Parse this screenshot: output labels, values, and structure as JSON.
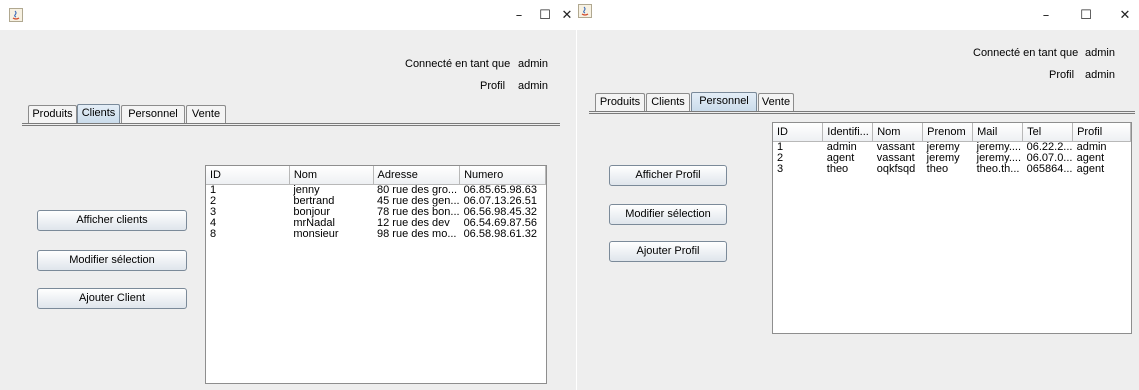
{
  "window_controls": {
    "minimize": "–",
    "maximize": "☐",
    "close": "✕"
  },
  "window1": {
    "user": {
      "connected_label": "Connecté en tant que",
      "connected_value": "admin",
      "profile_label": "Profil",
      "profile_value": "admin"
    },
    "tabs": [
      {
        "label": "Produits"
      },
      {
        "label": "Clients"
      },
      {
        "label": "Personnel"
      },
      {
        "label": "Vente"
      }
    ],
    "selected_tab": "Clients",
    "buttons": {
      "show": "Afficher clients",
      "edit": "Modifier sélection",
      "add": "Ajouter Client"
    },
    "table": {
      "columns": [
        "ID",
        "Nom",
        "Adresse",
        "Numero"
      ],
      "rows": [
        [
          "1",
          "jenny",
          "80 rue des gro...",
          "06.85.65.98.63"
        ],
        [
          "2",
          "bertrand",
          "45 rue des gen...",
          "06.07.13.26.51"
        ],
        [
          "3",
          "bonjour",
          "78 rue des bon...",
          "06.56.98.45.32"
        ],
        [
          "4",
          "mrNadal",
          "12 rue des dev",
          "06.54.69.87.56"
        ],
        [
          "8",
          "monsieur",
          "98 rue des mo...",
          "06.58.98.61.32"
        ]
      ]
    }
  },
  "window2": {
    "user": {
      "connected_label": "Connecté en tant que",
      "connected_value": "admin",
      "profile_label": "Profil",
      "profile_value": "admin"
    },
    "tabs": [
      {
        "label": "Produits"
      },
      {
        "label": "Clients"
      },
      {
        "label": "Personnel"
      },
      {
        "label": "Vente"
      }
    ],
    "selected_tab": "Personnel",
    "buttons": {
      "show": "Afficher Profil",
      "edit": "Modifier sélection",
      "add": "Ajouter Profil"
    },
    "table": {
      "columns": [
        "ID",
        "Identifi...",
        "Nom",
        "Prenom",
        "Mail",
        "Tel",
        "Profil"
      ],
      "rows": [
        [
          "1",
          "admin",
          "vassant",
          "jeremy",
          "jeremy....",
          "06.22.2...",
          "admin"
        ],
        [
          "2",
          "agent",
          "vassant",
          "jeremy",
          "jeremy....",
          "06.07.0...",
          "agent"
        ],
        [
          "3",
          "theo",
          "oqkfsqd",
          "theo",
          "theo.th...",
          "065864...",
          "agent"
        ]
      ]
    }
  }
}
